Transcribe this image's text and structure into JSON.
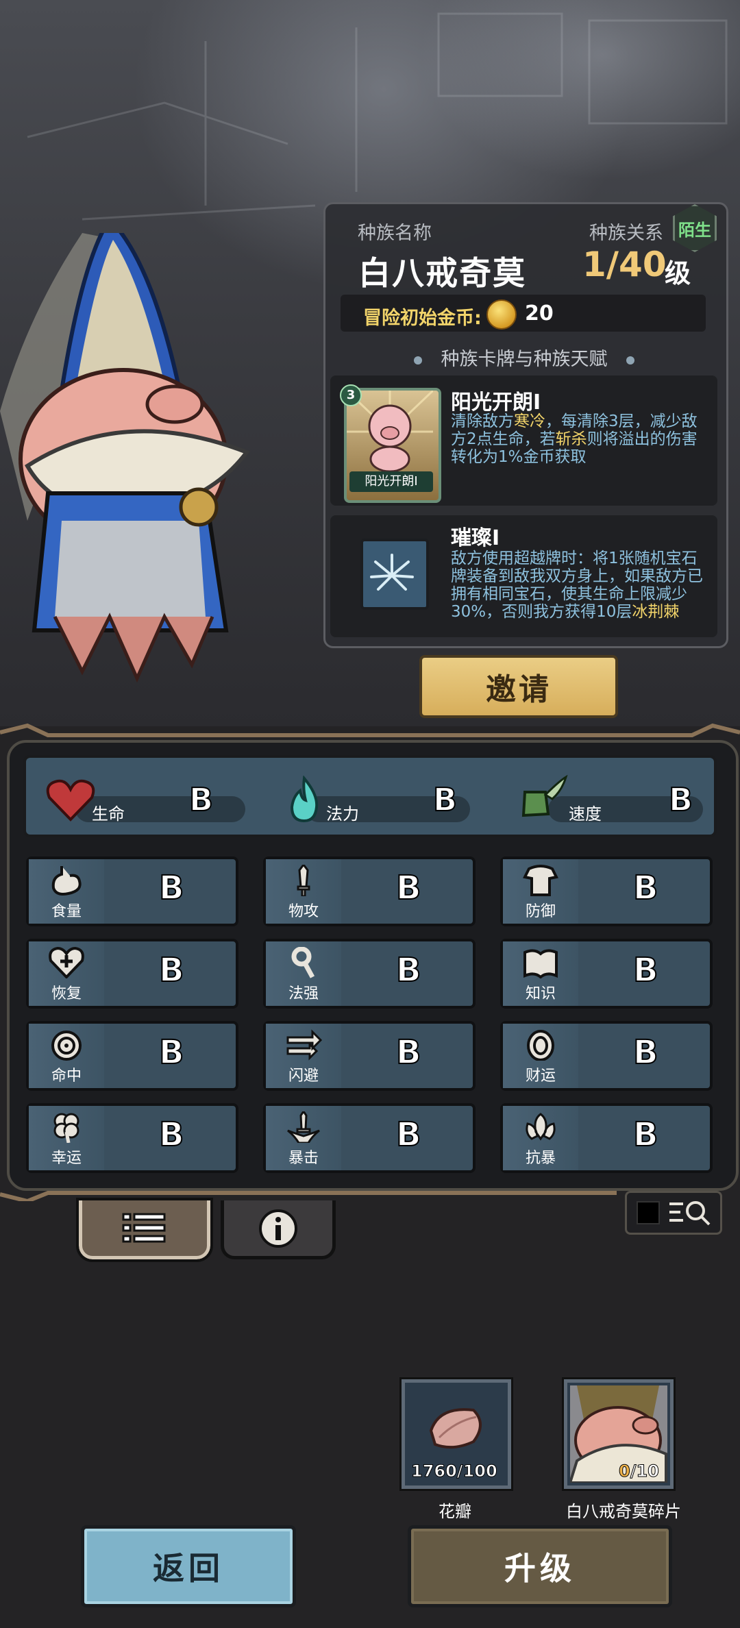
{
  "race": {
    "name_label": "种族名称",
    "name": "白八戒奇莫",
    "relation_label": "种族关系",
    "relation": "陌生",
    "level": "1/40",
    "level_unit": "级",
    "gold_label": "冒险初始金币:",
    "gold_value": "20",
    "section_title": "种族卡牌与种族天赋"
  },
  "talents": [
    {
      "title": "阳光开朗I",
      "card_caption": "阳光开朗I",
      "card_count": "3",
      "desc_parts": [
        "清除敌方",
        "寒冷",
        "，每清除3层，减少敌方2点生命，若",
        "斩杀",
        "则将溢出的伤害转化为1%金币获取"
      ]
    },
    {
      "title": "璀璨I",
      "desc_parts": [
        "敌方使用超越牌时：将1张随机宝石牌装备到敌我双方身上，如果敌方已拥有相同宝石，使其生命上限减少30%，否则我方获得10层",
        "冰荆棘"
      ]
    }
  ],
  "invite_label": "邀请",
  "main_stats": [
    {
      "label": "生命",
      "grade": "B",
      "icon": "heart-icon"
    },
    {
      "label": "法力",
      "grade": "B",
      "icon": "mana-flame-icon"
    },
    {
      "label": "速度",
      "grade": "B",
      "icon": "winged-boot-icon"
    }
  ],
  "stats": [
    {
      "label": "食量",
      "grade": "B",
      "icon": "stomach-icon"
    },
    {
      "label": "物攻",
      "grade": "B",
      "icon": "sword-icon"
    },
    {
      "label": "防御",
      "grade": "B",
      "icon": "armor-icon"
    },
    {
      "label": "恢复",
      "grade": "B",
      "icon": "heal-heart-icon"
    },
    {
      "label": "法强",
      "grade": "B",
      "icon": "magic-staff-icon"
    },
    {
      "label": "知识",
      "grade": "B",
      "icon": "book-icon"
    },
    {
      "label": "命中",
      "grade": "B",
      "icon": "target-icon"
    },
    {
      "label": "闪避",
      "grade": "B",
      "icon": "dodge-arrows-icon"
    },
    {
      "label": "财运",
      "grade": "B",
      "icon": "coin-icon"
    },
    {
      "label": "幸运",
      "grade": "B",
      "icon": "clover-icon"
    },
    {
      "label": "暴击",
      "grade": "B",
      "icon": "crit-blade-icon"
    },
    {
      "label": "抗暴",
      "grade": "B",
      "icon": "shield-flower-icon"
    }
  ],
  "resources": [
    {
      "name": "花瓣",
      "count": "1760/100",
      "icon": "petal-icon"
    },
    {
      "name": "白八戒奇莫碎片",
      "count_have": "0",
      "count_need": "/10",
      "icon": "pig-portrait-icon"
    }
  ],
  "buttons": {
    "back": "返回",
    "upgrade": "升级"
  },
  "colors": {
    "accent_gold": "#f2d46a",
    "relation_green": "#7fe08a",
    "desc_blue": "#8ec2df",
    "stat_panel": "#3d5566"
  }
}
